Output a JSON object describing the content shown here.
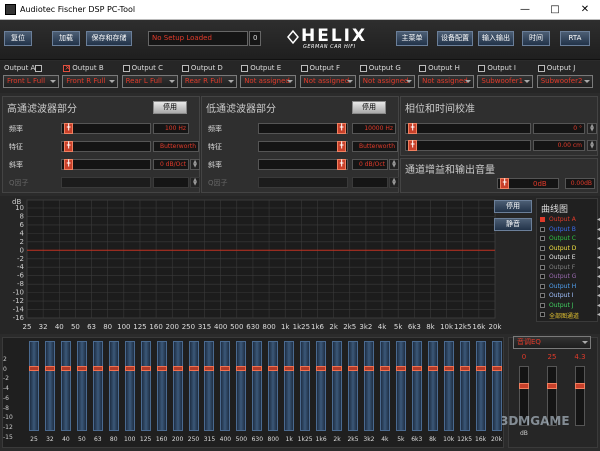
{
  "window": {
    "title": "Audiotec Fischer DSP PC-Tool",
    "min": "—",
    "max": "□",
    "close": "✕"
  },
  "toolbar": {
    "reset": "复位",
    "load": "加载",
    "save": "保存和存储",
    "setup_status": "No Setup Loaded",
    "setup_num": "0",
    "main_menu": "主菜单",
    "device_config": "设备配置",
    "io": "输入输出",
    "time": "时间",
    "rta": "RTA"
  },
  "logo": {
    "brand": "HELIX",
    "tagline": "GERMAN CAR HIFI"
  },
  "outputs": [
    {
      "name": "Output A",
      "assign": "Front L Full",
      "checked": false
    },
    {
      "name": "Output B",
      "assign": "Front R Full",
      "checked": true
    },
    {
      "name": "Output C",
      "assign": "Rear L Full",
      "checked": false
    },
    {
      "name": "Output D",
      "assign": "Rear R Full",
      "checked": false
    },
    {
      "name": "Output E",
      "assign": "Not assigned",
      "checked": false
    },
    {
      "name": "Output F",
      "assign": "Not assigned",
      "checked": false
    },
    {
      "name": "Output G",
      "assign": "Not assigned",
      "checked": false
    },
    {
      "name": "Output H",
      "assign": "Not assigned",
      "checked": false
    },
    {
      "name": "Output I",
      "assign": "Subwoofer1",
      "checked": false
    },
    {
      "name": "Output J",
      "assign": "Subwoofer2",
      "checked": false
    }
  ],
  "highpass": {
    "title": "高通滤波器部分",
    "toggle": "停用",
    "freq_label": "频率",
    "freq": "100 Hz",
    "char_label": "特征",
    "char": "Butterworth",
    "slope_label": "斜率",
    "slope": "0 dB/Oct",
    "q_label": "Q因子",
    "q": ""
  },
  "lowpass": {
    "title": "低通滤波器部分",
    "toggle": "停用",
    "freq_label": "频率",
    "freq": "10000 Hz",
    "char_label": "特征",
    "char": "Butterworth",
    "slope_label": "斜率",
    "slope": "0 dB/Oct",
    "q_label": "Q因子",
    "q": ""
  },
  "phase": {
    "title": "相位和时间校准",
    "phase_val": "0 °",
    "time_val": "0.00 cm"
  },
  "gain": {
    "title": "通道增益和输出音量",
    "db_label": "0dB",
    "value": "0.00dB"
  },
  "graph": {
    "y_unit": "dB",
    "y_ticks": [
      "10",
      "8",
      "6",
      "4",
      "2",
      "0",
      "-2",
      "-4",
      "-6",
      "-8",
      "-10",
      "-12",
      "-14",
      "-16"
    ],
    "x_ticks": [
      "25",
      "32",
      "40",
      "50",
      "63",
      "80",
      "100",
      "125",
      "160",
      "200",
      "250",
      "315",
      "400",
      "500",
      "630",
      "800",
      "1k",
      "1k25",
      "1k6",
      "2k",
      "2k5",
      "3k2",
      "4k",
      "5k",
      "6k3",
      "8k",
      "10k",
      "12k5",
      "16k",
      "20k"
    ],
    "btn_disable": "停用",
    "btn_mute": "静音",
    "legend_title": "曲线图",
    "legend": [
      {
        "name": "Output A",
        "color": "#e03a2a",
        "checked": true
      },
      {
        "name": "Output B",
        "color": "#3a6ef0",
        "checked": false
      },
      {
        "name": "Output C",
        "color": "#30c040",
        "checked": false
      },
      {
        "name": "Output D",
        "color": "#f0e040",
        "checked": false
      },
      {
        "name": "Output E",
        "color": "#e8e8e8",
        "checked": false
      },
      {
        "name": "Output F",
        "color": "#808080",
        "checked": false
      },
      {
        "name": "Output G",
        "color": "#9a6ab0",
        "checked": false
      },
      {
        "name": "Output H",
        "color": "#50a0f0",
        "checked": false
      },
      {
        "name": "Output I",
        "color": "#a0c0ff",
        "checked": false
      },
      {
        "name": "Output J",
        "color": "#40d060",
        "checked": false
      },
      {
        "name": "全部图通道",
        "color": "#e0c030",
        "checked": false
      }
    ],
    "zero_line_color": "#c03020"
  },
  "eq": {
    "db_ticks": [
      "2",
      "0",
      "-2",
      "-4",
      "-6",
      "-8",
      "-10",
      "-12",
      "-15"
    ],
    "bands": [
      "25",
      "32",
      "40",
      "50",
      "63",
      "80",
      "100",
      "125",
      "160",
      "200",
      "250",
      "315",
      "400",
      "500",
      "630",
      "800",
      "1k",
      "1k25",
      "1k6",
      "2k",
      "2k5",
      "3k2",
      "4k",
      "5k",
      "6k3",
      "8k",
      "10k",
      "12k5",
      "16k",
      "20k"
    ],
    "mode": "音调EQ",
    "param_vals": [
      "0",
      "25",
      "4.3"
    ],
    "param_unit": "dB"
  },
  "watermark": "3DMGAME"
}
